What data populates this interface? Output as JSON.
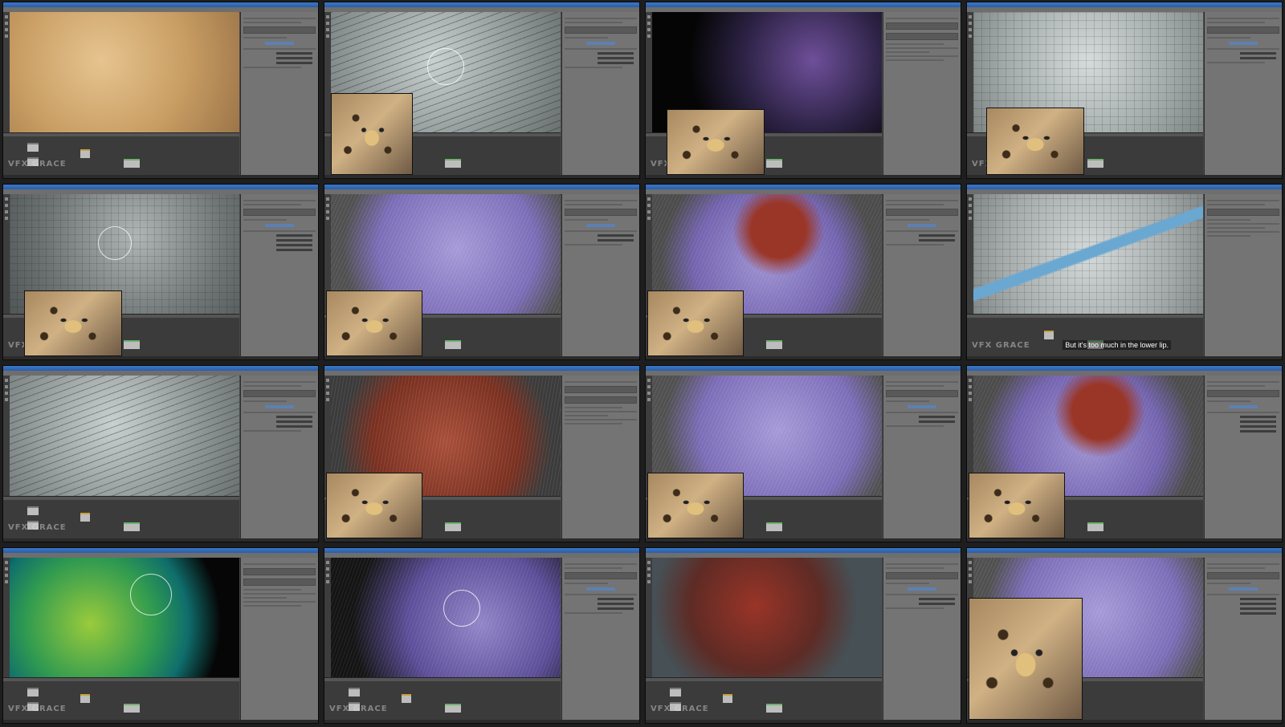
{
  "watermark": "VFX GRACE",
  "subtitle": "But it's too much in the lower lip.",
  "icons": {
    "title_bar": "window-title-bar",
    "node": "shader-node"
  },
  "colors": {
    "title_bar": "#2f66b3",
    "background": "#1e1e1e",
    "panel": "#747474"
  }
}
